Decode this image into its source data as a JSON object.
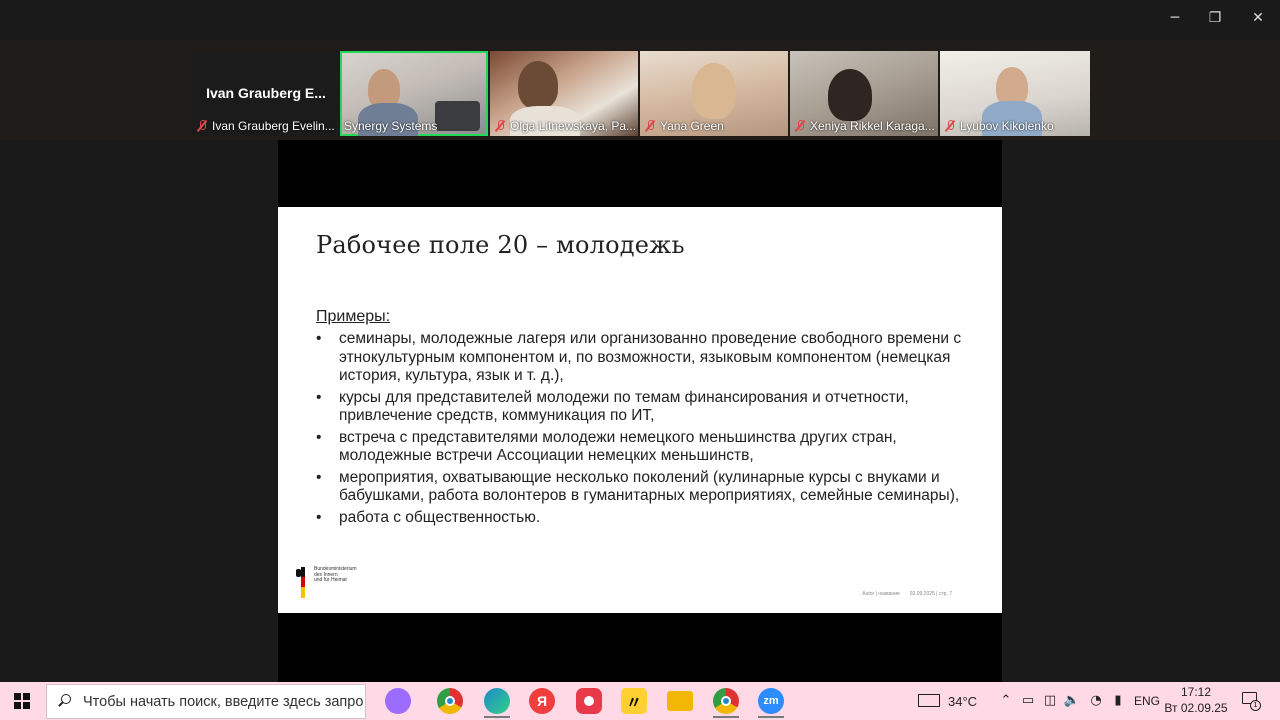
{
  "window": {
    "minimize_glyph": "─",
    "maximize_glyph": "❐",
    "close_glyph": "✕"
  },
  "participants": [
    {
      "display": "Ivan Grauberg E...",
      "name": "Ivan Grauberg Evelin...",
      "muted": true
    },
    {
      "name": "Synergy Systems",
      "muted": false,
      "active_speaker": true
    },
    {
      "name": "Olga Litnewskaya, Pa...",
      "muted": true
    },
    {
      "name": "Yana Green",
      "muted": true
    },
    {
      "name": "Xeniya Rikkel Karaga...",
      "muted": true
    },
    {
      "name": "Lyubov Kikolenko",
      "muted": true
    }
  ],
  "slide": {
    "title": "Рабочее поле 20 – молодежь",
    "section_label": "Примеры:",
    "bullets": [
      "семинары, молодежные лагеря или организованно проведение свободного времени с этнокультурным компонентом и, по возможности, языковым компонентом (немецкая история, культура, язык и т. д.),",
      "курсы для представителей молодежи по темам финансирования и отчетности, привлечение средств, коммуникация по ИТ,",
      "встреча с представителями молодежи немецкого меньшинства других стран, молодежные встречи Ассоциации немецких меньшинств,",
      "мероприятия, охватывающие несколько поколений (кулинарные курсы с внуками и бабушками, работа волонтеров в гуманитарных мероприятиях, семейные семинары),",
      "работа с общественностью."
    ],
    "logo_text_1": "Bundesministerium",
    "logo_text_2": "des Innern",
    "logo_text_3": "und für Heimat",
    "footer_author": "Autor | название",
    "footer_date_page": "02.09.2025 | стр. 7"
  },
  "taskbar": {
    "search_placeholder": "Чтобы начать поиск, введите здесь запрос",
    "apps": [
      {
        "icon": "copilot-icon",
        "color": "#9b6cff"
      },
      {
        "icon": "chrome-icon",
        "color": "#2f9e44"
      },
      {
        "icon": "edge-icon",
        "color": "#1e88c8"
      },
      {
        "icon": "yandex-browser-icon",
        "color": "#f03e3e",
        "glyph": "Я"
      },
      {
        "icon": "yandex-music-icon",
        "color": "#e8394a"
      },
      {
        "icon": "miro-icon",
        "color": "#ffd02f"
      },
      {
        "icon": "file-explorer-icon",
        "color": "#f2b705"
      },
      {
        "icon": "chrome-profile-icon",
        "color": "#2f9e44"
      },
      {
        "icon": "zoom-icon",
        "color": "#2d8cff",
        "glyph": "zm"
      }
    ],
    "weather": "34°C",
    "language": "ENG",
    "time": "17:12",
    "date": "Вт 02.09.25",
    "notification_count": "1"
  }
}
